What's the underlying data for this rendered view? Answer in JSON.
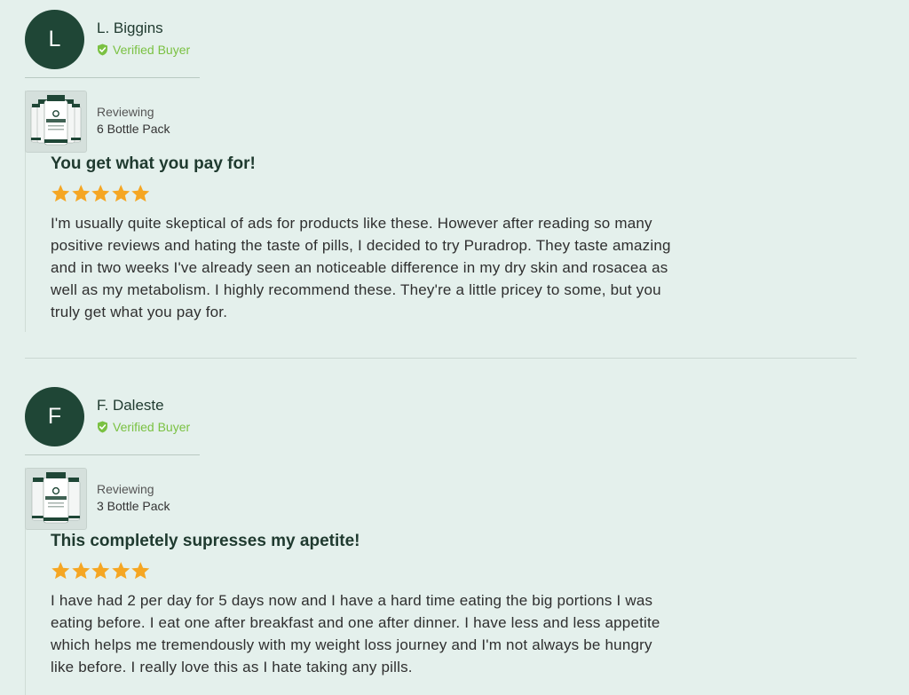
{
  "colors": {
    "background": "#e4f0ec",
    "avatar": "#1f4636",
    "verified": "#7ac142",
    "star": "#f5a623",
    "title": "#1f3a2f"
  },
  "reviews": [
    {
      "avatar_letter": "L",
      "name": "L. Biggins",
      "verified_label": "Verified Buyer",
      "verified_icon": "shield-check-icon",
      "reviewing_label": "Reviewing",
      "product": "6 Bottle Pack",
      "product_image": "six-bottle-pack",
      "title": "You get what you pay for!",
      "rating": 5,
      "rating_max": 5,
      "body": "I'm usually quite skeptical of ads for products like these. However after reading so many positive reviews and hating the taste of pills, I decided to try Puradrop. They taste amazing and in two weeks I've already seen an noticeable difference in my dry skin and rosacea as well as my metabolism. I highly recommend these. They're a little pricey to some, but you truly get what you pay for."
    },
    {
      "avatar_letter": "F",
      "name": "F. Daleste",
      "verified_label": "Verified Buyer",
      "verified_icon": "shield-check-icon",
      "reviewing_label": "Reviewing",
      "product": "3 Bottle Pack",
      "product_image": "three-bottle-pack",
      "title": "This completely supresses my apetite!",
      "rating": 5,
      "rating_max": 5,
      "body": "I have had 2 per day for 5 days now and I have a hard time eating the big portions I was eating before. I eat one after breakfast and one after dinner. I have less and less appetite which helps me tremendously with my weight loss journey and I'm not always be hungry like before. I really love this as I hate taking any pills."
    }
  ]
}
